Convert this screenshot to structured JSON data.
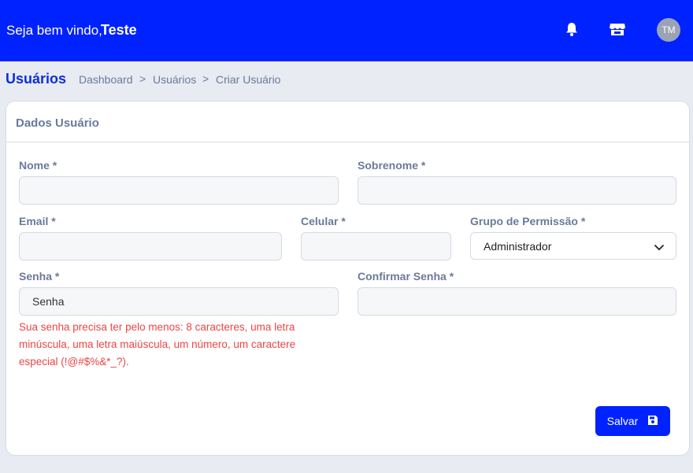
{
  "header": {
    "welcome_text": "Seja bem vindo,",
    "user_name": "Teste",
    "avatar_initials": "TM",
    "bg_color": "#0022ff",
    "icons": [
      "bell-icon",
      "store-icon"
    ]
  },
  "page": {
    "title": "Usuários",
    "breadcrumb": [
      "Dashboard",
      "Usuários",
      "Criar Usuário"
    ],
    "breadcrumb_sep": ">"
  },
  "card": {
    "title": "Dados Usuário"
  },
  "form": {
    "nome": {
      "label": "Nome *",
      "value": ""
    },
    "sobrenome": {
      "label": "Sobrenome *",
      "value": ""
    },
    "email": {
      "label": "Email *",
      "value": ""
    },
    "celular": {
      "label": "Celular *",
      "value": ""
    },
    "grupo": {
      "label": "Grupo de Permissão *",
      "selected": "Administrador"
    },
    "senha": {
      "label": "Senha *",
      "placeholder": "Senha"
    },
    "confirmar_senha": {
      "label": "Confirmar Senha *",
      "value": ""
    },
    "password_hint": "Sua senha precisa ter pelo menos: 8 caracteres, uma letra minúscula, uma letra maiúscula, um número, um caractere especial (!@#$%&*_?).",
    "hint_color": "#ef4444"
  },
  "actions": {
    "save_label": "Salvar",
    "save_icon": "floppy-disk-icon"
  }
}
